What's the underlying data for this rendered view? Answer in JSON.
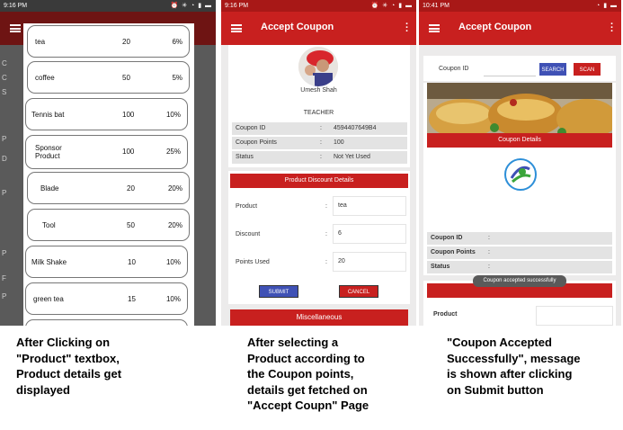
{
  "panel1": {
    "status": {
      "time": "9:16 PM",
      "icons": "⏰ ✳ ◔ ▮ ▬"
    },
    "background_labels": [
      "C",
      "C",
      "S",
      "P",
      "D",
      "P",
      "P",
      "F",
      "P"
    ],
    "products": [
      {
        "name": "tea",
        "points": "20",
        "discount": "6%"
      },
      {
        "name": "coffee",
        "points": "50",
        "discount": "5%"
      },
      {
        "name": "Tennis bat",
        "points": "100",
        "discount": "10%"
      },
      {
        "name": "Sponsor Product",
        "points": "100",
        "discount": "25%"
      },
      {
        "name": "Blade",
        "points": "20",
        "discount": "20%"
      },
      {
        "name": "Tool",
        "points": "50",
        "discount": "20%"
      },
      {
        "name": "Milk Shake",
        "points": "10",
        "discount": "10%"
      },
      {
        "name": "green tea",
        "points": "15",
        "discount": "10%"
      }
    ],
    "caption": "After Clicking on\n\"Product\" textbox,\nProduct details get\ndisplayed"
  },
  "panel2": {
    "status": {
      "time": "9:16 PM",
      "icons": "⏰ ✳ ◔ ▮ ▬"
    },
    "title": "Accept Coupon",
    "user_name": "Umesh Shah",
    "role": "TEACHER",
    "info": [
      {
        "label": "Coupon ID",
        "value": "4594407649B4"
      },
      {
        "label": "Coupon Points",
        "value": "100"
      },
      {
        "label": "Status",
        "value": "Not Yet Used"
      }
    ],
    "section_title": "Product Discount Details",
    "fields": [
      {
        "label": "Product",
        "value": "tea"
      },
      {
        "label": "Discount",
        "value": "6"
      },
      {
        "label": "Points Used",
        "value": "20"
      }
    ],
    "submit_label": "SUBMIT",
    "cancel_label": "CANCEL",
    "misc_label": "Miscellaneous",
    "caption": "After selecting a\nProduct according to\nthe Coupon points,\ndetails get fetched on\n\"Accept Coupn\" Page"
  },
  "panel3": {
    "status": {
      "time": "10:41 PM",
      "icons": "◔ ▮ ▬"
    },
    "title": "Accept Coupon",
    "coupon_id_label": "Coupon ID",
    "search_label": "SEARCH",
    "scan_label": "SCAN",
    "coupon_details_label": "Coupon Details",
    "info": [
      {
        "label": "Coupon ID"
      },
      {
        "label": "Coupon Points"
      },
      {
        "label": "Status"
      }
    ],
    "toast": "Coupon accepted successfully",
    "product_label": "Product",
    "caption": "\"Coupon Accepted\nSuccessfully\", message\nis shown after clicking\non Submit button"
  }
}
